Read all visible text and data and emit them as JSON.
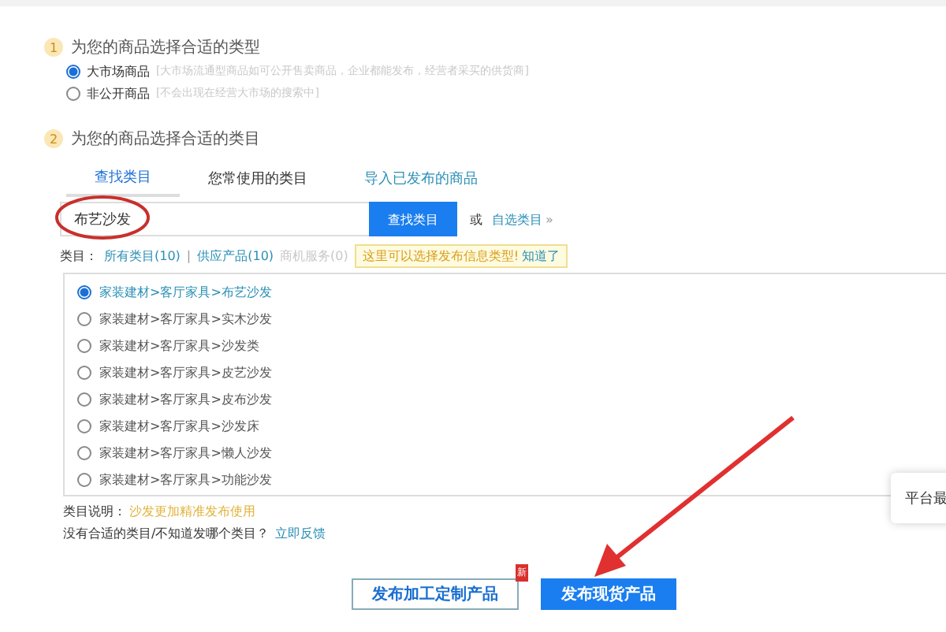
{
  "step1": {
    "number": "1",
    "title": "为您的商品选择合适的类型",
    "options": [
      {
        "label": "大市场商品",
        "hint": "[大市场流通型商品如可公开售卖商品，企业都能发布，经营者采买的供货商]",
        "selected": true
      },
      {
        "label": "非公开商品",
        "hint": "[不会出现在经营大市场的搜索中]",
        "selected": false
      }
    ]
  },
  "step2": {
    "number": "2",
    "title": "为您的商品选择合适的类目",
    "tabs": [
      {
        "label": "查找类目",
        "selected": true,
        "kind": "tab"
      },
      {
        "label": "您常使用的类目",
        "selected": false,
        "kind": "tab"
      },
      {
        "label": "导入已发布的商品",
        "selected": false,
        "kind": "link"
      }
    ],
    "search": {
      "value": "布艺沙发",
      "button": "查找类目",
      "or": "或",
      "custom": "自选类目",
      "caret": "»"
    },
    "filter": {
      "label": "类目：",
      "items": [
        {
          "label": "所有类目(10)",
          "disabled": false
        },
        {
          "label": "供应产品(10)",
          "disabled": false
        },
        {
          "label": "商机服务(0)",
          "disabled": true
        }
      ],
      "separator": "|",
      "tip": "这里可以选择发布信息类型!",
      "tip_link": "知道了"
    },
    "categories": [
      {
        "label": "家装建材>客厅家具>布艺沙发",
        "selected": true
      },
      {
        "label": "家装建材>客厅家具>实木沙发",
        "selected": false
      },
      {
        "label": "家装建材>客厅家具>沙发类",
        "selected": false
      },
      {
        "label": "家装建材>客厅家具>皮艺沙发",
        "selected": false
      },
      {
        "label": "家装建材>客厅家具>皮布沙发",
        "selected": false
      },
      {
        "label": "家装建材>客厅家具>沙发床",
        "selected": false
      },
      {
        "label": "家装建材>客厅家具>懒人沙发",
        "selected": false
      },
      {
        "label": "家装建材>客厅家具>功能沙发",
        "selected": false
      }
    ],
    "note_label": "类目说明：",
    "note": "沙发更加精准发布使用",
    "help": "没有合适的类目/不知道发哪个类目？",
    "help_link": "立即反馈"
  },
  "popup": "平台最",
  "buttons": [
    {
      "label": "发布加工定制产品",
      "kind": "outline",
      "badge": "新"
    },
    {
      "label": "发布现货产品",
      "kind": "primary"
    }
  ]
}
